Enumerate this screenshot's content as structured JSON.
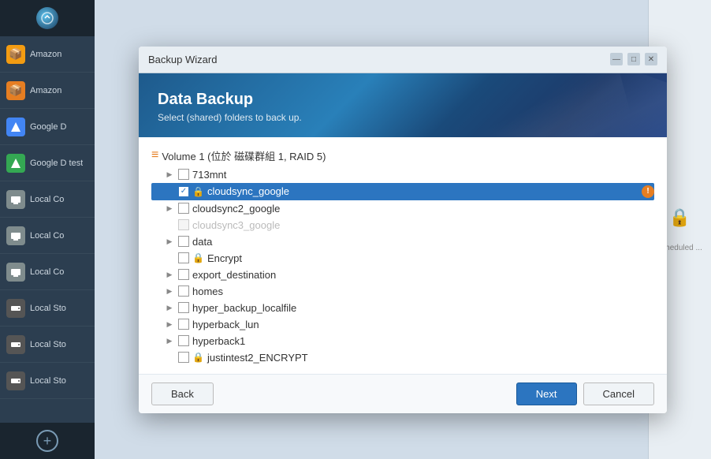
{
  "sidebar": {
    "items": [
      {
        "label": "Amazon",
        "icon": "📦",
        "color": "#f39c12"
      },
      {
        "label": "Amazon",
        "icon": "📦",
        "color": "#f39c12"
      },
      {
        "label": "Google D",
        "icon": "△",
        "color": "#4285f4"
      },
      {
        "label": "Google D test",
        "icon": "△",
        "color": "#34a853"
      },
      {
        "label": "Local Co",
        "icon": "🖥",
        "color": "#7f8c8d"
      },
      {
        "label": "Local Co",
        "icon": "🖥",
        "color": "#7f8c8d"
      },
      {
        "label": "Local Co",
        "icon": "🖥",
        "color": "#7f8c8d"
      },
      {
        "label": "Local Sto",
        "icon": "💾",
        "color": "#7f8c8d"
      },
      {
        "label": "Local Sto",
        "icon": "💾",
        "color": "#7f8c8d"
      },
      {
        "label": "Local Sto",
        "icon": "💾",
        "color": "#7f8c8d"
      }
    ],
    "add_label": "+"
  },
  "dialog": {
    "title": "Backup Wizard",
    "banner_title": "Data Backup",
    "banner_subtitle": "Select (shared) folders to back up.",
    "volume_label": "Volume 1 (位於 磁碟群組 1, RAID 5)",
    "folders": [
      {
        "name": "713mnt",
        "level": 1,
        "has_expand": true,
        "checked": false,
        "disabled": false,
        "lock": false,
        "warning": false
      },
      {
        "name": "cloudsync_google",
        "level": 1,
        "has_expand": false,
        "checked": true,
        "selected": true,
        "disabled": false,
        "lock": true,
        "warning": true
      },
      {
        "name": "cloudsync2_google",
        "level": 1,
        "has_expand": true,
        "checked": false,
        "disabled": false,
        "lock": false,
        "warning": false
      },
      {
        "name": "cloudsync3_google",
        "level": 1,
        "has_expand": false,
        "checked": false,
        "disabled": true,
        "lock": false,
        "warning": false
      },
      {
        "name": "data",
        "level": 1,
        "has_expand": true,
        "checked": false,
        "disabled": false,
        "lock": false,
        "warning": false
      },
      {
        "name": "Encrypt",
        "level": 1,
        "has_expand": false,
        "checked": false,
        "disabled": false,
        "lock": true,
        "warning": false
      },
      {
        "name": "export_destination",
        "level": 1,
        "has_expand": true,
        "checked": false,
        "disabled": false,
        "lock": false,
        "warning": false
      },
      {
        "name": "homes",
        "level": 1,
        "has_expand": true,
        "checked": false,
        "disabled": false,
        "lock": false,
        "warning": false
      },
      {
        "name": "hyper_backup_localfile",
        "level": 1,
        "has_expand": true,
        "checked": false,
        "disabled": false,
        "lock": false,
        "warning": false
      },
      {
        "name": "hyperback_lun",
        "level": 1,
        "has_expand": true,
        "checked": false,
        "disabled": false,
        "lock": false,
        "warning": false
      },
      {
        "name": "hyperback1",
        "level": 1,
        "has_expand": true,
        "checked": false,
        "disabled": false,
        "lock": false,
        "warning": false
      },
      {
        "name": "justintest2_ENCRYPT",
        "level": 1,
        "has_expand": false,
        "checked": false,
        "disabled": false,
        "lock": true,
        "warning": false
      }
    ],
    "back_label": "Back",
    "next_label": "Next",
    "cancel_label": "Cancel"
  },
  "right_panel": {
    "lock_icon": "🔒",
    "scheduled_label": "scheduled ..."
  }
}
